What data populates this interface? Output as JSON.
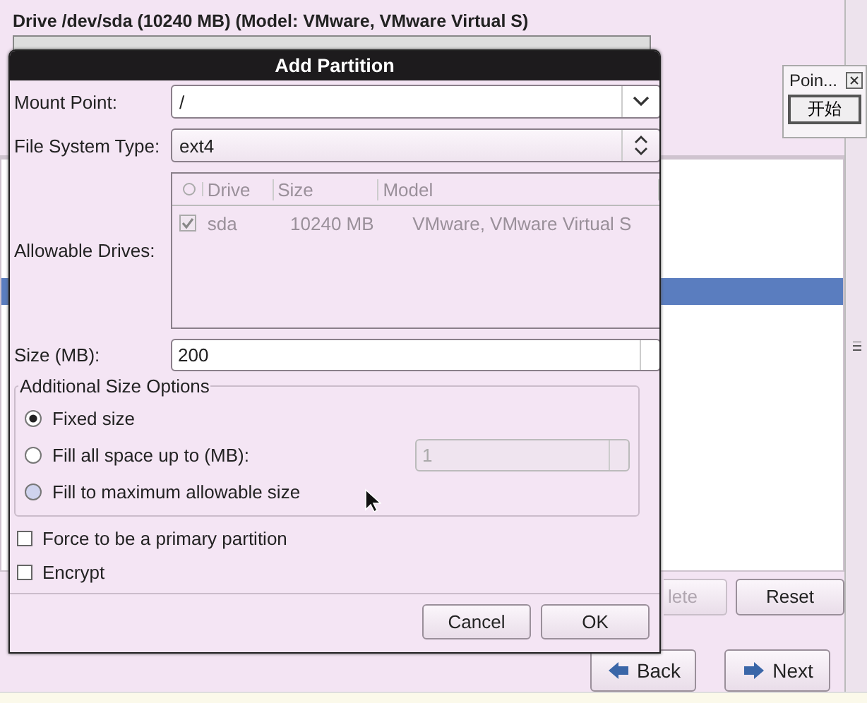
{
  "background_window": {
    "drive_title": "Drive /dev/sda (10240 MB) (Model: VMware, VMware Virtual S)",
    "buttons": [
      {
        "label": "lete",
        "disabled": true
      },
      {
        "label": "Reset",
        "disabled": false
      }
    ],
    "nav_buttons": [
      {
        "label": "Back",
        "kind": "back"
      },
      {
        "label": "Next",
        "kind": "next"
      }
    ]
  },
  "dialog": {
    "title": "Add Partition",
    "mount_point": {
      "label": "Mount Point:",
      "value": "/"
    },
    "file_system_type": {
      "label": "File System Type:",
      "value": "ext4"
    },
    "allowable_drives": {
      "label": "Allowable Drives:",
      "disabled": true,
      "columns": [
        "Drive",
        "Size",
        "Model"
      ],
      "rows": [
        {
          "checked": true,
          "cells": [
            "sda",
            "10240 MB",
            "VMware, VMware Virtual S"
          ]
        }
      ]
    },
    "size": {
      "label": "Size (MB):",
      "value": "200"
    },
    "size_options": {
      "legend": "Additional Size Options",
      "options": [
        {
          "label": "Fixed size",
          "selected": true,
          "hovered": false
        },
        {
          "label": "Fill all space up to (MB):",
          "selected": false,
          "hovered": false,
          "field": {
            "value": "1",
            "disabled": true
          }
        },
        {
          "label": "Fill to maximum allowable size",
          "selected": false,
          "hovered": true
        }
      ]
    },
    "checkboxes": [
      {
        "label": "Force to be a primary partition",
        "checked": false
      },
      {
        "label": "Encrypt",
        "checked": false
      }
    ],
    "buttons": [
      "Cancel",
      "OK"
    ]
  },
  "mini_window": {
    "title": "Poin...",
    "button": "开始"
  }
}
